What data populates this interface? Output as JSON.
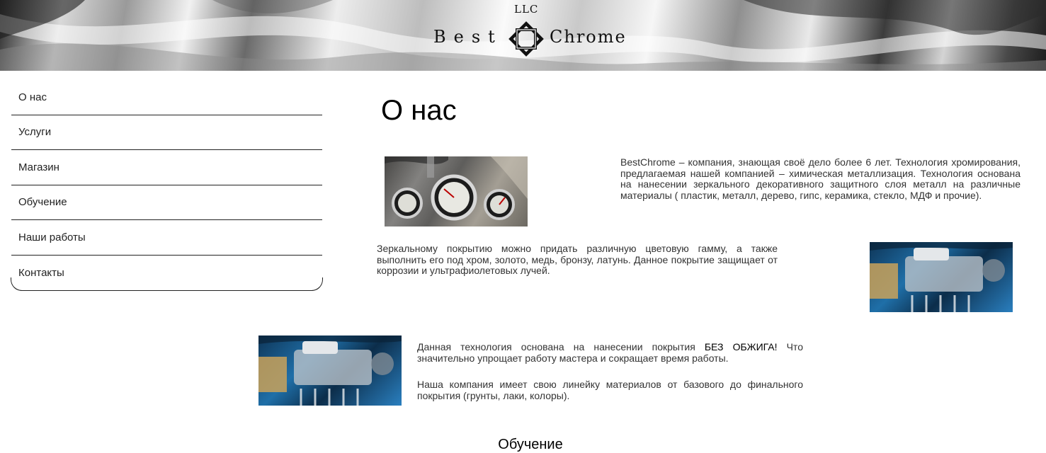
{
  "header": {
    "logo_llc": "LLC",
    "logo_best": "Best",
    "logo_chrome": "Chrome"
  },
  "sidebar": {
    "items": [
      {
        "label": "О нас"
      },
      {
        "label": "Услуги"
      },
      {
        "label": "Магазин"
      },
      {
        "label": "Обучение"
      },
      {
        "label": "Наши работы"
      },
      {
        "label": "Контакты"
      }
    ]
  },
  "main": {
    "title": "О нас",
    "paragraph1": "BestChrome – компания, знающая своё дело более 6 лет. Технология хромирования, предлагаемая нашей компанией – химическая металлизация. Технология основана на нанесении зеркального декоративного защитного слоя металл на различные материалы ( пластик, металл, дерево, гипс, керамика, стекло, МДФ и прочие).",
    "paragraph2": "Зеркальному покрытию можно придать различную цветовую гамму, а также выполнить его под хром, золото, медь, бронзу, латунь. Данное покрытие защищает от коррозии и ультрафиолетовых лучей.",
    "paragraph3_before": "Данная технология основана на нанесении покрытия ",
    "paragraph3_emphasis": "БЕЗ ОБЖИГА!",
    "paragraph3_after": " Что значительно упрощает работу мастера и сокращает время работы.",
    "paragraph4": "Наша компания имеет свою линейку материалов от базового до финального покрытия (грунты, лаки, колоры).",
    "section_heading": "Обучение"
  },
  "colors": {
    "text": "#333333",
    "heading": "#000000",
    "divider": "#222222",
    "engine_blue": "#1f6fa8"
  },
  "icons": {
    "logo_mark": "celtic-knot-icon"
  }
}
